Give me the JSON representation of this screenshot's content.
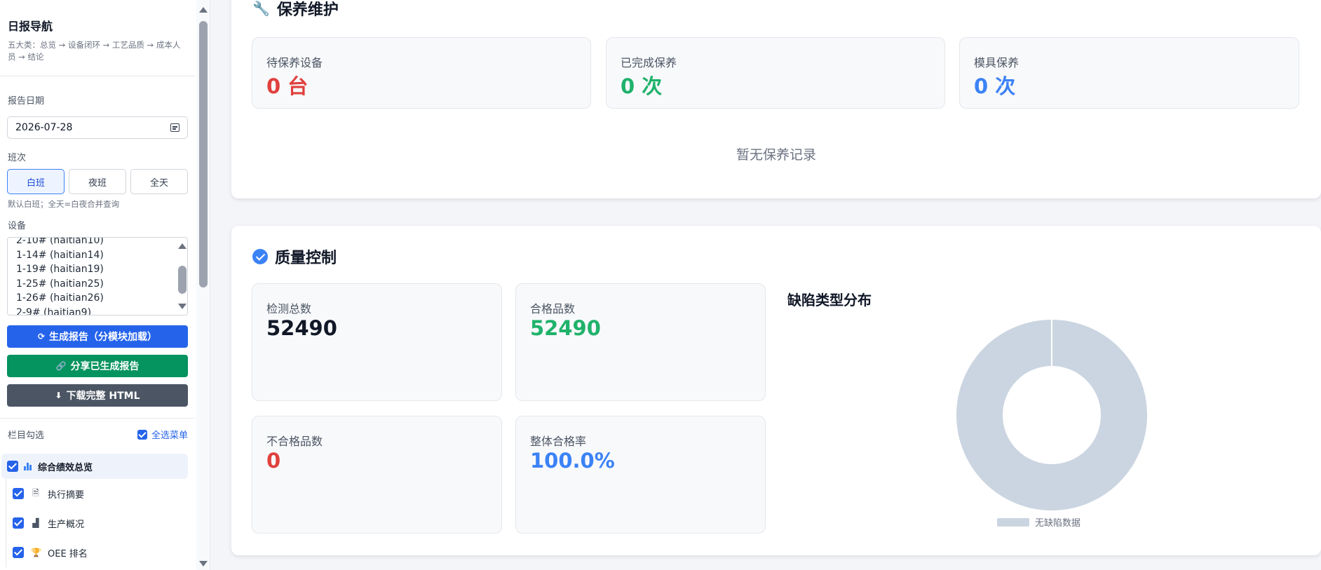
{
  "sidebar": {
    "title": "日报导航",
    "desc": "五大类：总览 → 设备闭环 → 工艺品质 → 成本人员 → 结论",
    "date_label": "报告日期",
    "date_value": "2026-07-28",
    "shift_label": "班次",
    "shifts": [
      "白班",
      "夜班",
      "全天"
    ],
    "active_shift": "白班",
    "shift_hint": "默认白班；全天=白夜合并查询",
    "device_label": "设备",
    "devices": [
      "2-10# (haitian10)",
      "1-14# (haitian14)",
      "1-19# (haitian19)",
      "1-25# (haitian25)",
      "1-26# (haitian26)",
      "2-9# (haitian9)"
    ],
    "buttons": {
      "generate": "生成报告（分模块加载）",
      "share": "分享已生成报告",
      "download": "下载完整 HTML"
    },
    "menu_label": "栏目勾选",
    "select_all": "全选菜单",
    "group": "综合绩效总览",
    "items": [
      "执行摘要",
      "生产概况",
      "OEE 排名"
    ]
  },
  "maintenance": {
    "title": "保养维护",
    "stats": [
      {
        "label": "待保养设备",
        "value": "0 台"
      },
      {
        "label": "已完成保养",
        "value": "0 次"
      },
      {
        "label": "模具保养",
        "value": "0 次"
      }
    ],
    "empty": "暂无保养记录"
  },
  "quality": {
    "title": "质量控制",
    "stats": [
      {
        "label": "检测总数",
        "value": "52490"
      },
      {
        "label": "合格品数",
        "value": "52490"
      },
      {
        "label": "不合格品数",
        "value": "0"
      },
      {
        "label": "整体合格率",
        "value": "100.0%"
      }
    ],
    "chart_title": "缺陷类型分布",
    "legend": "无缺陷数据"
  },
  "chart_data": {
    "type": "pie",
    "title": "缺陷类型分布",
    "labels": [
      "无缺陷数据"
    ],
    "values": [
      1
    ],
    "colors": [
      "#cbd5e1"
    ],
    "donut": true,
    "legend_position": "bottom"
  },
  "colors": {
    "primary": "#2563eb",
    "success": "#05935f",
    "danger": "#e0413d",
    "value_green": "#1fb26b",
    "value_blue": "#3b82f6"
  }
}
